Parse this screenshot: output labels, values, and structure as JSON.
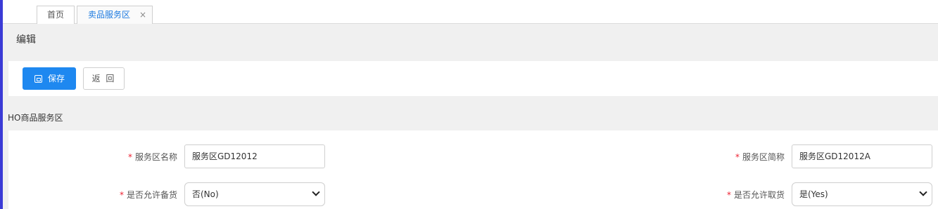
{
  "tabs": [
    {
      "label": "首页"
    },
    {
      "label": "卖品服务区",
      "close": "×"
    }
  ],
  "header": {
    "title": "编辑"
  },
  "toolbar": {
    "save_label": "保存",
    "back_label": "返 回"
  },
  "section": {
    "title": "HO商品服务区"
  },
  "form": {
    "name": {
      "label": "服务区名称",
      "value": "服务区GD12012"
    },
    "short_name": {
      "label": "服务区简称",
      "value": "服务区GD12012A"
    },
    "allow_stock": {
      "label": "是否允许备货",
      "value": "否(No)"
    },
    "allow_pickup": {
      "label": "是否允许取货",
      "value": "是(Yes)"
    },
    "required_mark": "*"
  },
  "colors": {
    "accent": "#1e88f0",
    "tab_active": "#1e7be0",
    "required": "#ee2233"
  }
}
